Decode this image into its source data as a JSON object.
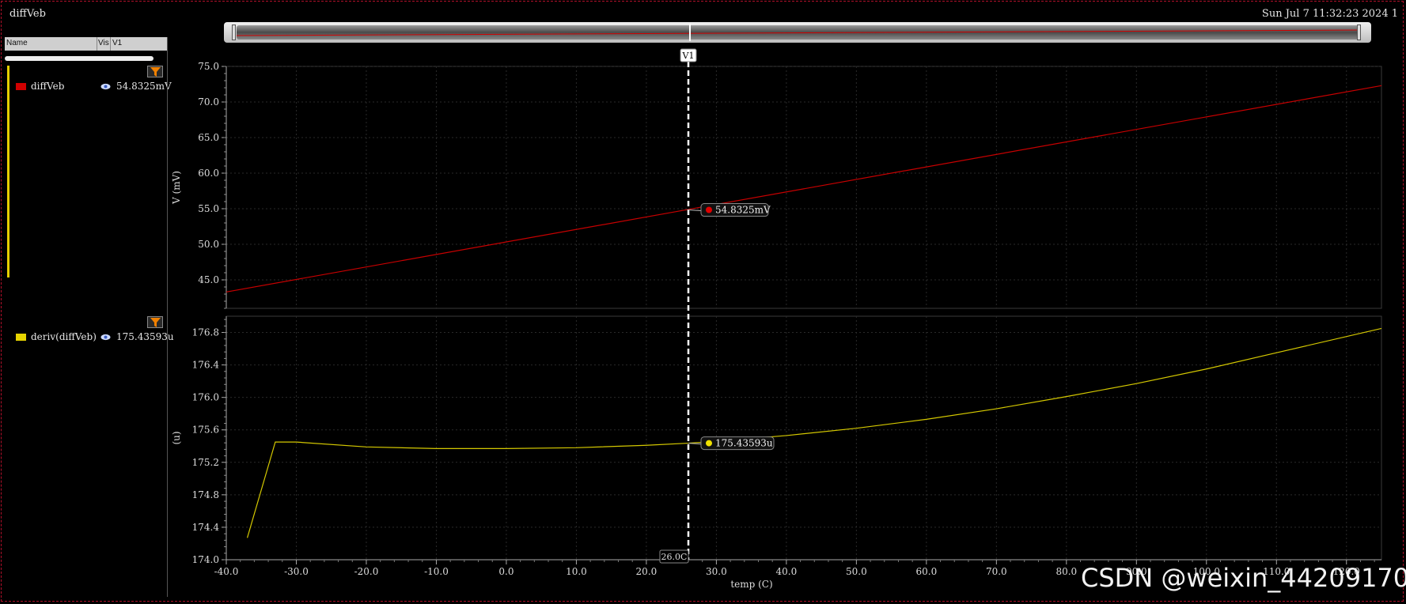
{
  "window": {
    "title": "diffVeb",
    "timestamp": "Sun Jul 7 11:32:23 2024  1"
  },
  "panel": {
    "columns": {
      "name": "Name",
      "vis": "Vis",
      "v1": "V1"
    },
    "signals": [
      {
        "name": "diffVeb",
        "value": "54.8325mV",
        "color": "#d00000"
      },
      {
        "name": "deriv(diffVeb)",
        "value": "175.43593u",
        "color": "#e6d400"
      }
    ]
  },
  "cursor": {
    "label": "V1",
    "x_value": 26.0,
    "x_label": "26.0C",
    "top_marker": "54.8325mV",
    "bottom_marker": "175.43593u"
  },
  "watermark": "CSDN @weixin_44209170",
  "chart_data": [
    {
      "type": "line",
      "ylabel": "V (mV)",
      "xlim": [
        -40,
        125
      ],
      "ylim": [
        41,
        75
      ],
      "yticks": [
        "45.0",
        "50.0",
        "55.0",
        "60.0",
        "65.0",
        "70.0",
        "75.0"
      ],
      "grid": true,
      "series": [
        {
          "name": "diffVeb",
          "color": "#c80000",
          "x": [
            -40,
            125
          ],
          "y": [
            43.3,
            72.3
          ]
        }
      ]
    },
    {
      "type": "line",
      "ylabel": "(u)",
      "xlabel": "temp (C)",
      "xlim": [
        -40,
        125
      ],
      "ylim": [
        174.0,
        177.0
      ],
      "yticks": [
        "174.0",
        "174.4",
        "174.8",
        "175.2",
        "175.6",
        "176.0",
        "176.4",
        "176.8"
      ],
      "xticks": [
        "-40.0",
        "-30.0",
        "-20.0",
        "-10.0",
        "0.0",
        "10.0",
        "20.0",
        "30.0",
        "40.0",
        "50.0",
        "60.0",
        "70.0",
        "80.0",
        "90.0",
        "100.0",
        "110.0",
        "120.0"
      ],
      "grid": true,
      "series": [
        {
          "name": "deriv(diffVeb)",
          "color": "#d4c800",
          "x": [
            -37,
            -33,
            -30,
            -20,
            -10,
            0,
            10,
            20,
            26,
            30,
            40,
            50,
            60,
            70,
            80,
            90,
            100,
            110,
            125
          ],
          "y": [
            174.27,
            175.45,
            175.45,
            175.39,
            175.37,
            175.37,
            175.38,
            175.41,
            175.436,
            175.46,
            175.53,
            175.62,
            175.73,
            175.86,
            176.01,
            176.17,
            176.35,
            176.55,
            176.85
          ]
        }
      ]
    }
  ]
}
